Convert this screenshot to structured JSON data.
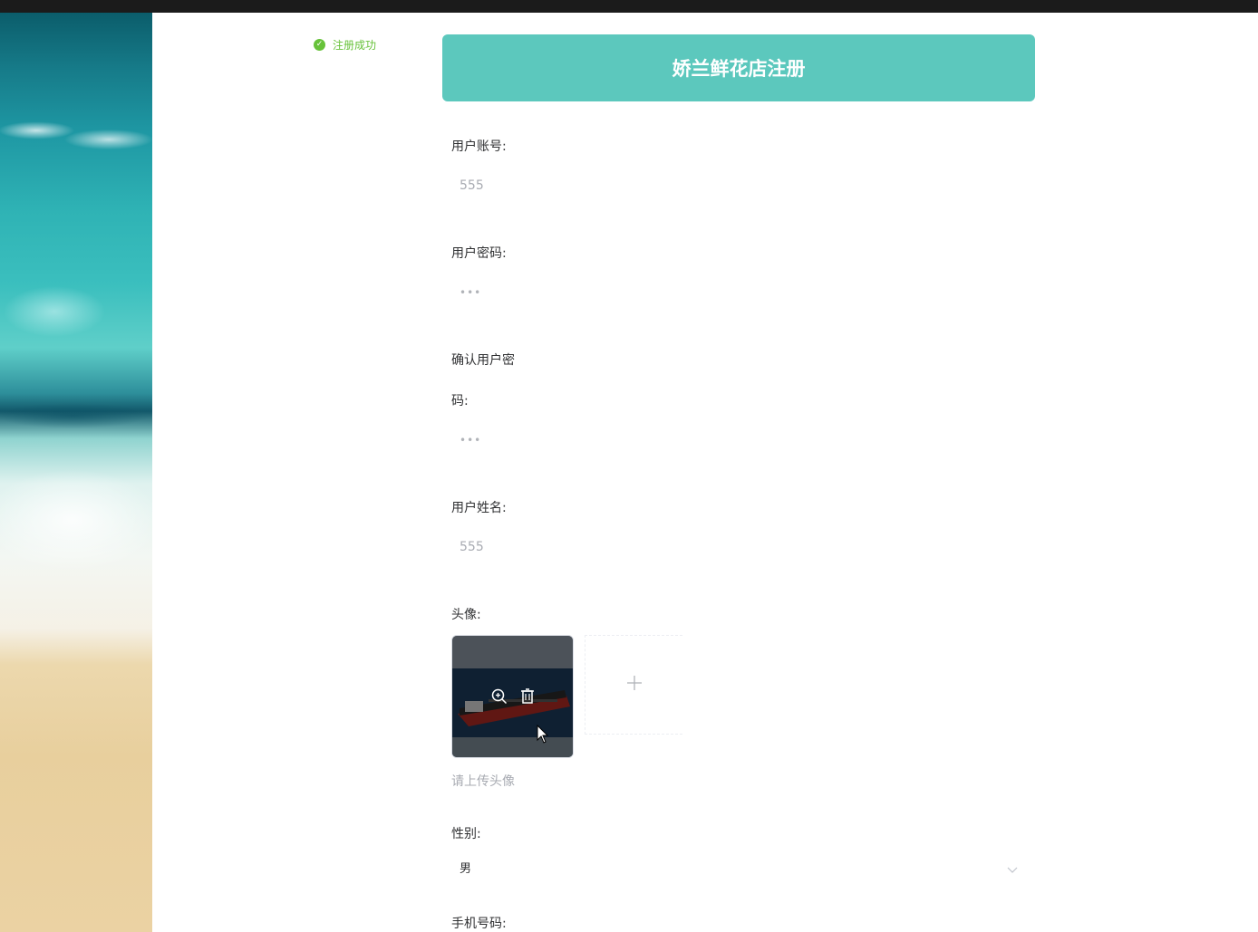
{
  "toast": {
    "message": "注册成功",
    "icon": "check-circle-icon",
    "color": "#67c23a"
  },
  "header": {
    "title": "娇兰鲜花店注册",
    "color": "#5cc8bd"
  },
  "form": {
    "account": {
      "label": "用户账号:",
      "value": "555"
    },
    "password": {
      "label": "用户密码:",
      "value": "•••"
    },
    "confirm_password": {
      "label_line1": "确认用户密",
      "label_line2": "码:",
      "value": "•••"
    },
    "name": {
      "label": "用户姓名:",
      "value": "555"
    },
    "avatar": {
      "label": "头像:",
      "hint": "请上传头像",
      "preview_icons": [
        "zoom-in-icon",
        "delete-icon"
      ],
      "add_icon": "plus-icon"
    },
    "gender": {
      "label": "性别:",
      "value": "男"
    },
    "phone": {
      "label": "手机号码:"
    }
  }
}
